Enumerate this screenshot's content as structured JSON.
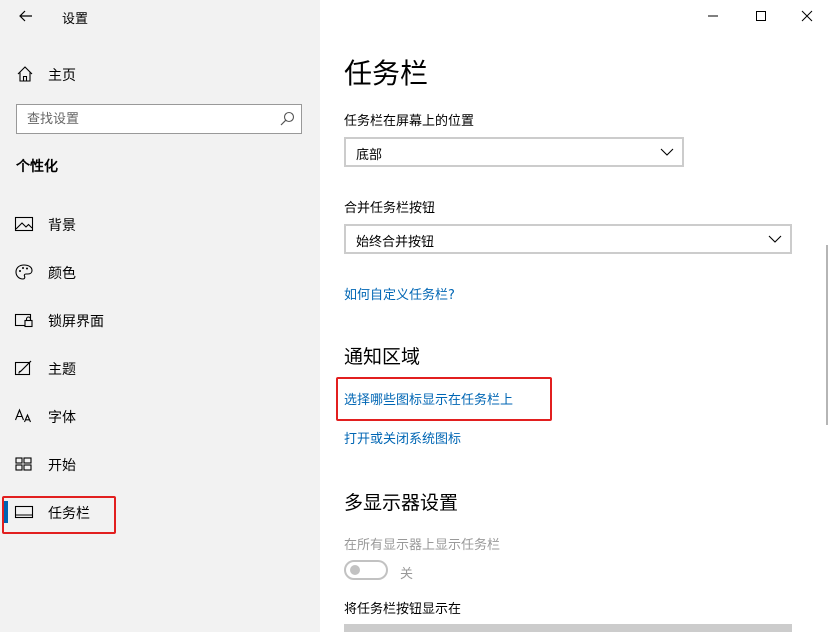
{
  "window": {
    "title": "设置"
  },
  "sidebar": {
    "home_label": "主页",
    "search_placeholder": "查找设置",
    "section_title": "个性化",
    "items": [
      {
        "label": "背景",
        "icon": "image-icon"
      },
      {
        "label": "颜色",
        "icon": "palette-icon"
      },
      {
        "label": "锁屏界面",
        "icon": "lock-screen-icon"
      },
      {
        "label": "主题",
        "icon": "theme-brush-icon"
      },
      {
        "label": "字体",
        "icon": "font-icon"
      },
      {
        "label": "开始",
        "icon": "start-grid-icon"
      },
      {
        "label": "任务栏",
        "icon": "taskbar-icon",
        "selected": true
      }
    ]
  },
  "main": {
    "title": "任务栏",
    "position_label": "任务栏在屏幕上的位置",
    "position_value": "底部",
    "combine_label": "合并任务栏按钮",
    "combine_value": "始终合并按钮",
    "customize_link": "如何自定义任务栏?",
    "notification_heading": "通知区域",
    "select_icons_link": "选择哪些图标显示在任务栏上",
    "system_icons_link": "打开或关闭系统图标",
    "multi_display_heading": "多显示器设置",
    "show_all_label": "在所有显示器上显示任务栏",
    "toggle_state": "关",
    "show_buttons_label": "将任务栏按钮显示在"
  },
  "colors": {
    "accent": "#0063b1",
    "link": "#0066b4",
    "highlight": "#e21f1f",
    "sidebar_bg": "#f2f2f2"
  }
}
